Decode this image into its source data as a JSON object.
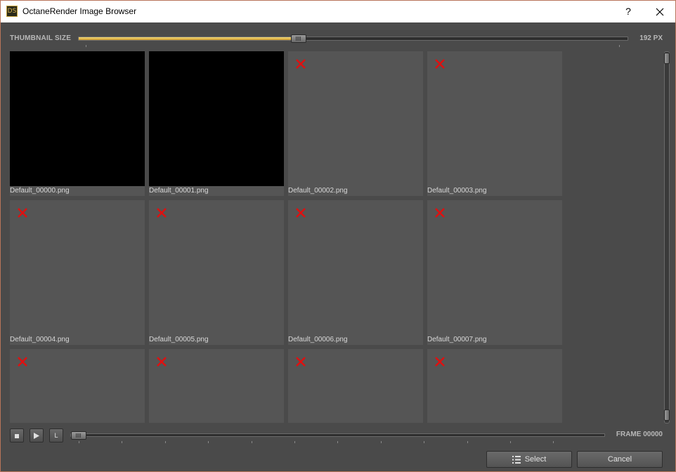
{
  "window": {
    "title": "OctaneRender Image Browser",
    "logo_text": "DS",
    "help_label": "?",
    "close_icon": "close-icon"
  },
  "thumbnail": {
    "label": "THUMBNAIL SIZE",
    "value": "192 PX",
    "slider_fraction": 0.4
  },
  "images": [
    {
      "name": "Default_00000.png",
      "status": "loaded"
    },
    {
      "name": "Default_00001.png",
      "status": "loaded"
    },
    {
      "name": "Default_00002.png",
      "status": "missing"
    },
    {
      "name": "Default_00003.png",
      "status": "missing"
    },
    {
      "name": "Default_00004.png",
      "status": "missing"
    },
    {
      "name": "Default_00005.png",
      "status": "missing"
    },
    {
      "name": "Default_00006.png",
      "status": "missing"
    },
    {
      "name": "Default_00007.png",
      "status": "missing"
    },
    {
      "name": "",
      "status": "missing"
    },
    {
      "name": "",
      "status": "missing"
    },
    {
      "name": "",
      "status": "missing"
    },
    {
      "name": "",
      "status": "missing"
    }
  ],
  "playback": {
    "stop_icon": "stop-icon",
    "play_icon": "play-icon",
    "loop_label": "L",
    "frame_label": "FRAME 00000",
    "frame_fraction": 0.0
  },
  "footer": {
    "select_label": "Select",
    "cancel_label": "Cancel"
  },
  "colors": {
    "accent": "#e6c04a",
    "missing_mark": "#e01010",
    "background": "#4a4a4a",
    "cell": "#555555"
  }
}
